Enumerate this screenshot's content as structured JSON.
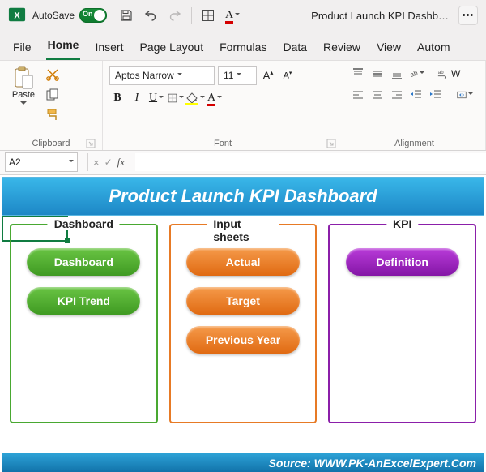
{
  "titlebar": {
    "autosave_label": "AutoSave",
    "autosave_state": "On",
    "doc_title": "Product Launch KPI Dashb…"
  },
  "tabs": [
    "File",
    "Home",
    "Insert",
    "Page Layout",
    "Formulas",
    "Data",
    "Review",
    "View",
    "Autom"
  ],
  "active_tab_index": 1,
  "ribbon": {
    "clipboard_label": "Clipboard",
    "paste_label": "Paste",
    "font_label": "Font",
    "font_name": "Aptos Narrow",
    "font_size": "11",
    "alignment_label": "Alignment",
    "wrap_label": "W"
  },
  "formula_bar": {
    "cell_ref": "A2",
    "formula": ""
  },
  "sheet": {
    "banner_title": "Product Launch KPI Dashboard",
    "panel_dashboard_title": "Dashboard",
    "panel_input_title": "Input sheets",
    "panel_kpi_title": "KPI",
    "btn_dashboard": "Dashboard",
    "btn_kpitrend": "KPI Trend",
    "btn_actual": "Actual",
    "btn_target": "Target",
    "btn_prev": "Previous Year",
    "btn_definition": "Definition",
    "footer_source": "Source: WWW.PK-AnExcelExpert.Com"
  }
}
